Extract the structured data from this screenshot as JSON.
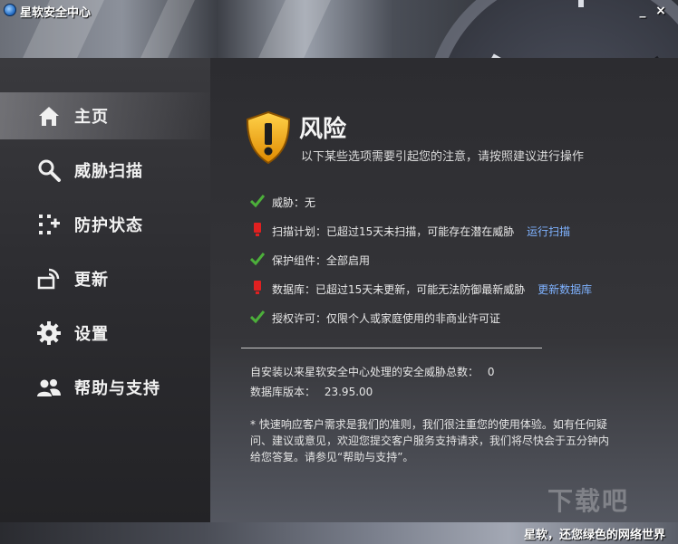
{
  "window": {
    "title": "星软安全中心",
    "minimize_label": "_",
    "close_label": "×"
  },
  "sidebar": {
    "items": [
      {
        "label": "主页",
        "icon": "home-icon",
        "active": true
      },
      {
        "label": "威胁扫描",
        "icon": "search-icon",
        "active": false
      },
      {
        "label": "防护状态",
        "icon": "protection-grid-icon",
        "active": false
      },
      {
        "label": "更新",
        "icon": "update-icon",
        "active": false
      },
      {
        "label": "设置",
        "icon": "gear-icon",
        "active": false
      },
      {
        "label": "帮助与支持",
        "icon": "users-icon",
        "active": false
      }
    ]
  },
  "main": {
    "risk_title": "风险",
    "risk_subtitle": "以下某些选项需要引起您的注意，请按照建议进行操作",
    "status_items": [
      {
        "status": "ok",
        "text": "威胁：无",
        "link": ""
      },
      {
        "status": "warning",
        "text": "扫描计划：已超过15天未扫描，可能存在潜在威胁",
        "link": "运行扫描"
      },
      {
        "status": "ok",
        "text": "保护组件：全部启用",
        "link": ""
      },
      {
        "status": "warning",
        "text": "数据库：已超过15天未更新，可能无法防御最新威胁",
        "link": "更新数据库"
      },
      {
        "status": "ok",
        "text": "授权许可：仅限个人或家庭使用的非商业许可证",
        "link": ""
      }
    ],
    "threats_handled_label": "自安装以来星软安全中心处理的安全威胁总数：",
    "threats_handled_value": "0",
    "db_version_label": "数据库版本：",
    "db_version_value": "23.95.00",
    "note": "* 快速响应客户需求是我们的准则，我们很注重您的使用体验。如有任何疑问、建议或意见，欢迎您提交客户服务支持请求，我们将尽快会于五分钟内给您答复。请参见“帮助与支持”。"
  },
  "footer": {
    "slogan": "星软，还您绿色的网络世界"
  },
  "watermark": "下载吧",
  "colors": {
    "link": "#7fb2ff",
    "ok_check": "#4caf3a",
    "warning": "#e02020"
  }
}
